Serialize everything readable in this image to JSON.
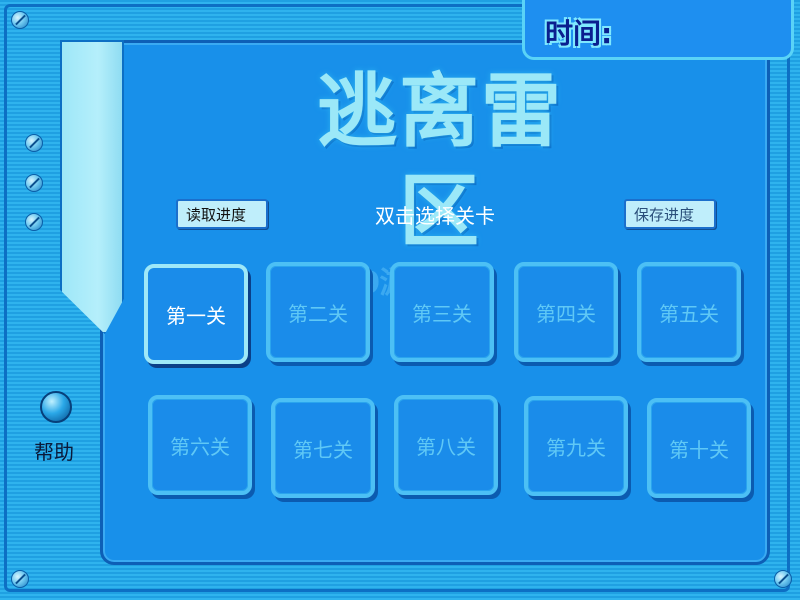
{
  "header": {
    "time_label": "时间:"
  },
  "title": "逃离雷区",
  "controls": {
    "load_label": "读取进度",
    "save_label": "保存进度",
    "hint": "双击选择关卡"
  },
  "levels": [
    {
      "label": "第一关",
      "state": "unlocked"
    },
    {
      "label": "第二关",
      "state": "locked"
    },
    {
      "label": "第三关",
      "state": "locked"
    },
    {
      "label": "第四关",
      "state": "locked"
    },
    {
      "label": "第五关",
      "state": "locked"
    },
    {
      "label": "第六关",
      "state": "locked"
    },
    {
      "label": "第七关",
      "state": "locked"
    },
    {
      "label": "第八关",
      "state": "locked"
    },
    {
      "label": "第九关",
      "state": "locked"
    },
    {
      "label": "第十关",
      "state": "locked"
    }
  ],
  "help": {
    "label": "帮助"
  },
  "watermark": "4399游戏"
}
